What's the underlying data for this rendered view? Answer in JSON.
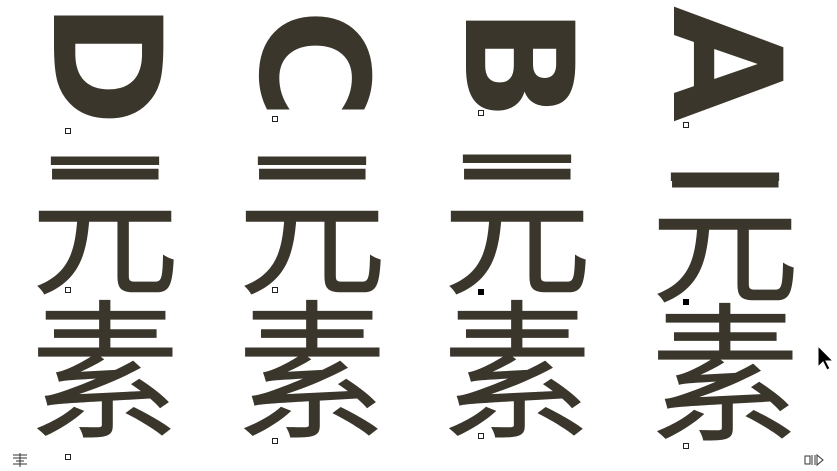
{
  "columns": [
    {
      "id": "d",
      "letter": "D",
      "dash": "—",
      "han1": "元",
      "han2": "素"
    },
    {
      "id": "c",
      "letter": "C",
      "dash": "—",
      "han1": "元",
      "han2": "素"
    },
    {
      "id": "b",
      "letter": "B",
      "dash": "—",
      "han1": "元",
      "han2": "素"
    },
    {
      "id": "a",
      "letter": "A",
      "dash": "—",
      "han1": "元",
      "han2": "素"
    }
  ],
  "colors": {
    "text": "#3b362c",
    "background": "#ffffff",
    "handle_border": "#222222"
  },
  "icons": {
    "cursor": "arrow-cursor-icon",
    "bottom_left": "text-frame-icon",
    "bottom_right": "overflow-icon"
  }
}
